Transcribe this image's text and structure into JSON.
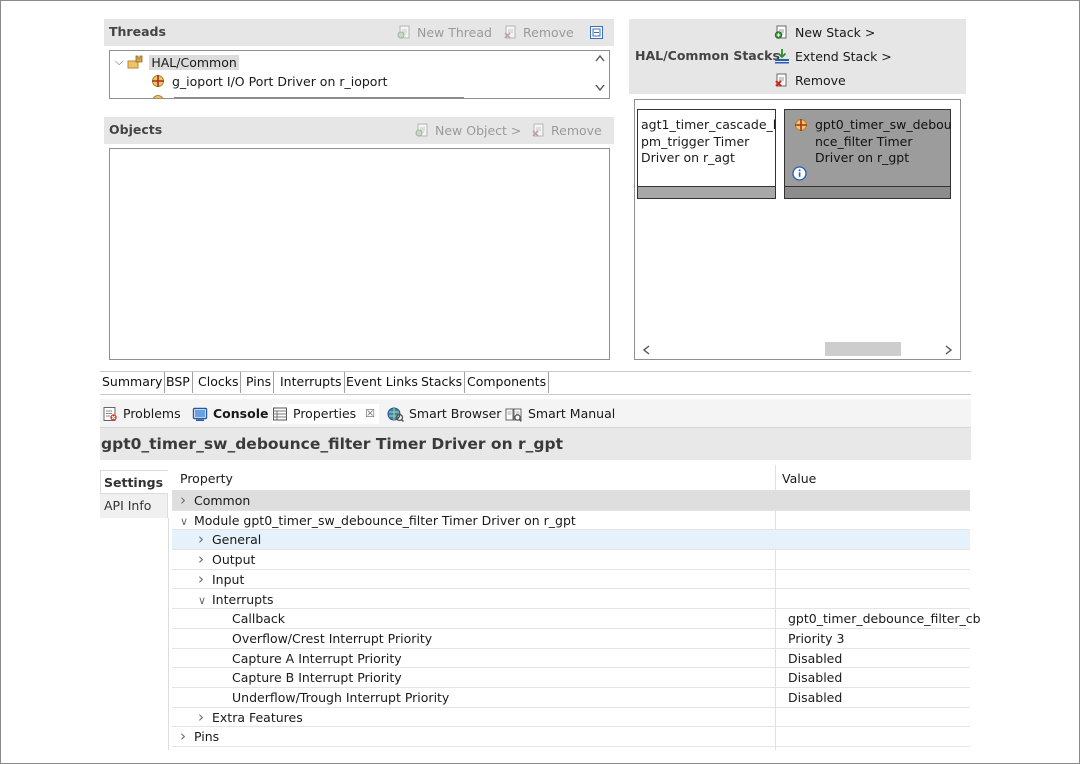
{
  "threads": {
    "title": "Threads",
    "new_thread": "New Thread",
    "remove": "Remove",
    "tree": {
      "root": "HAL/Common",
      "children": [
        "g_ioport I/O Port Driver on r_ioport"
      ]
    }
  },
  "objects": {
    "title": "Objects",
    "new_object": "New Object >",
    "remove": "Remove"
  },
  "stacks": {
    "title": "HAL/Common Stacks",
    "new_stack": "New Stack >",
    "extend_stack": "Extend Stack >",
    "remove": "Remove",
    "blocks": [
      {
        "lines": [
          "agt1_timer_cascade_l",
          "pm_trigger Timer",
          "Driver on r_agt"
        ],
        "selected": false
      },
      {
        "lines": [
          "gpt0_timer_sw_debou",
          "nce_filter Timer",
          "Driver on r_gpt"
        ],
        "selected": true
      }
    ]
  },
  "editor_tabs": [
    "Summary",
    "BSP",
    "Clocks",
    "Pins",
    "Interrupts",
    "Event Links",
    "Stacks",
    "Components"
  ],
  "view_tabs": {
    "problems": "Problems",
    "console": "Console",
    "properties": "Properties",
    "properties_close": "☒",
    "smart_browser": "Smart Browser",
    "smart_manual": "Smart Manual"
  },
  "properties": {
    "title": "gpt0_timer_sw_debounce_filter Timer Driver on r_gpt",
    "side_tabs": [
      "Settings",
      "API Info"
    ],
    "col_property": "Property",
    "col_value": "Value",
    "rows": [
      {
        "indent": 0,
        "expand": "collapsed",
        "label": "Common",
        "value": ""
      },
      {
        "indent": 0,
        "expand": "expanded",
        "label": "Module gpt0_timer_sw_debounce_filter Timer Driver on r_gpt",
        "value": ""
      },
      {
        "indent": 1,
        "expand": "collapsed",
        "label": "General",
        "value": ""
      },
      {
        "indent": 1,
        "expand": "collapsed",
        "label": "Output",
        "value": ""
      },
      {
        "indent": 1,
        "expand": "collapsed",
        "label": "Input",
        "value": ""
      },
      {
        "indent": 1,
        "expand": "expanded",
        "label": "Interrupts",
        "value": ""
      },
      {
        "indent": 2,
        "expand": "none",
        "label": "Callback",
        "value": "gpt0_timer_debounce_filter_cb"
      },
      {
        "indent": 2,
        "expand": "none",
        "label": "Overflow/Crest Interrupt Priority",
        "value": "Priority 3"
      },
      {
        "indent": 2,
        "expand": "none",
        "label": "Capture A Interrupt Priority",
        "value": "Disabled"
      },
      {
        "indent": 2,
        "expand": "none",
        "label": "Capture B Interrupt Priority",
        "value": "Disabled"
      },
      {
        "indent": 2,
        "expand": "none",
        "label": "Underflow/Trough Interrupt Priority",
        "value": "Disabled"
      },
      {
        "indent": 1,
        "expand": "collapsed",
        "label": "Extra Features",
        "value": ""
      },
      {
        "indent": 0,
        "expand": "collapsed",
        "label": "Pins",
        "value": ""
      }
    ]
  },
  "colors": {
    "header_bg": "#e6e6e6",
    "selected_row": "#e5f1fb",
    "selected_block": "#9c9c9c",
    "info_icon": "#1f5fbf"
  }
}
